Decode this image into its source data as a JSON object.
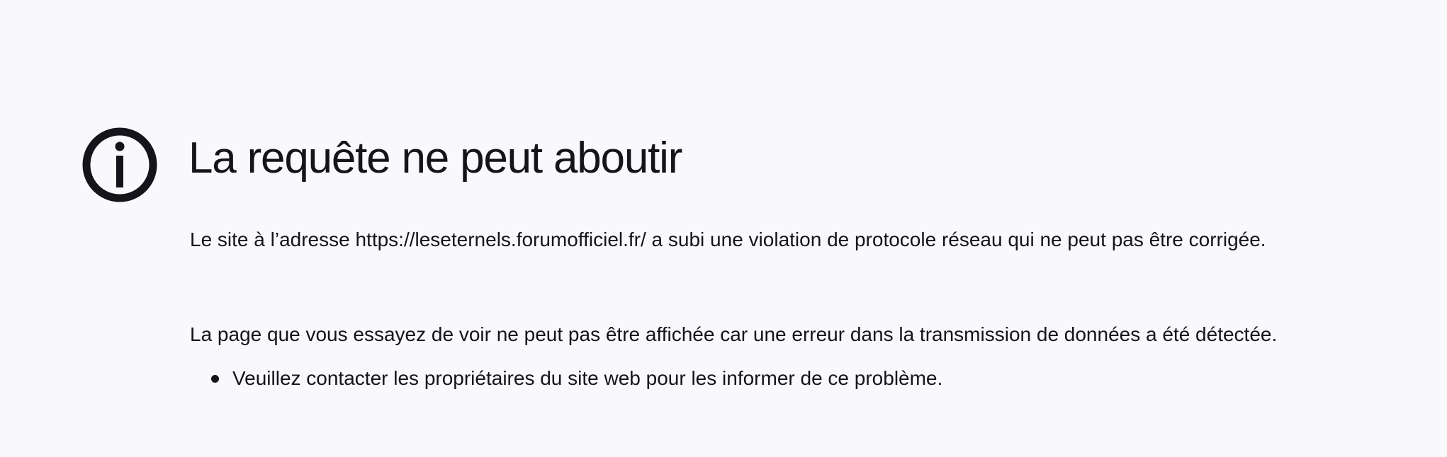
{
  "error_page": {
    "icon": "info-icon",
    "title": "La requête ne peut aboutir",
    "short_description": "Le site à l’adresse https://leseternels.forumofficiel.fr/ a subi une violation de protocole réseau qui ne peut pas être corrigée.",
    "long_description": "La page que vous essayez de voir ne peut pas être affichée car une erreur dans la transmission de données a été détectée.",
    "tips": [
      "Veuillez contacter les propriétaires du site web pour les informer de ce problème."
    ]
  }
}
